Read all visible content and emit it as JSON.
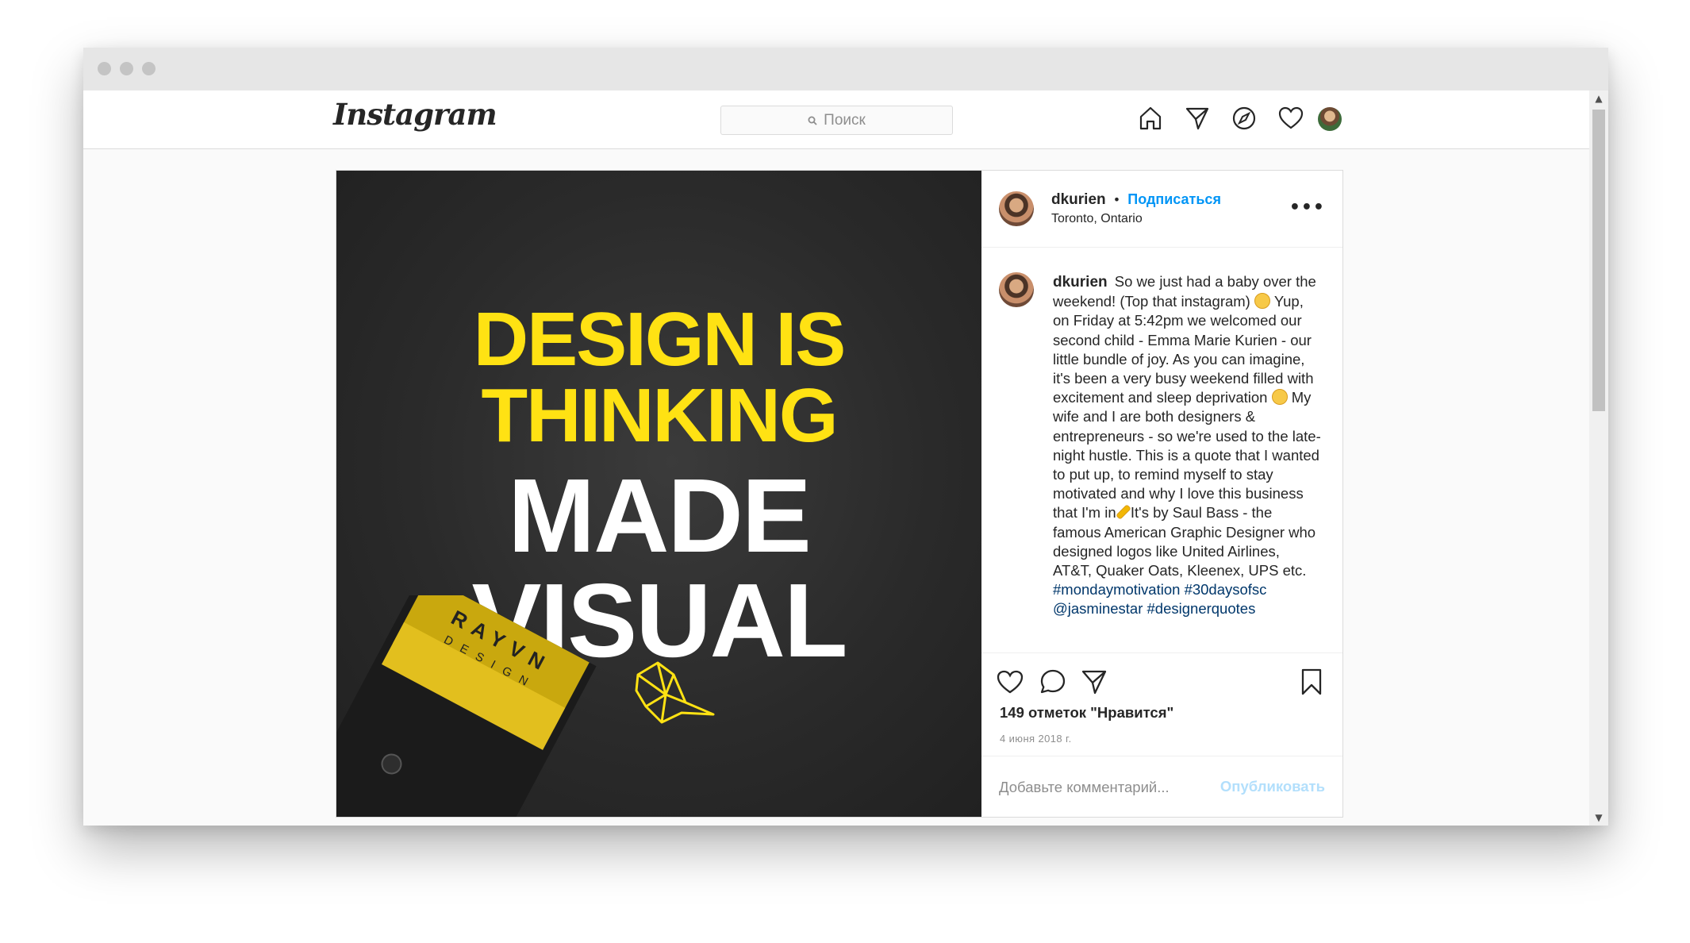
{
  "nav": {
    "logo": "Instagram",
    "search_placeholder": "Поиск",
    "icons": [
      "home-icon",
      "direct-icon",
      "explore-icon",
      "activity-icon",
      "profile-avatar"
    ]
  },
  "post": {
    "image_text": {
      "line1": "DESIGN IS",
      "line2": "THINKING",
      "line3": "MADE",
      "line4": "VISUAL",
      "envelope_brand": "RAYVN",
      "envelope_sub": "DESIGN"
    },
    "header": {
      "username": "dkurien",
      "separator": "•",
      "follow_label": "Подписаться",
      "location": "Toronto, Ontario"
    },
    "caption": {
      "username": "dkurien",
      "part1": "So we just had a baby over the weekend! (Top that instagram)",
      "part2": "Yup, on Friday at 5:42pm we welcomed our second child - Emma Marie Kurien - our little bundle of joy. As you can imagine, it's been a very busy weekend filled with excitement and sleep deprivation",
      "part3": "My wife and I are both designers & entrepreneurs - so we're used to the late-night hustle. This is a quote that I wanted to put up, to remind myself to stay motivated and why I love this business that I'm in",
      "part4": "It's by Saul Bass - the famous American Graphic Designer who designed logos like United Airlines, AT&T, Quaker Oats, Kleenex, UPS etc.",
      "tag1": "#mondaymotivation",
      "tag2": "#30daysofsc",
      "mention": "@jasminestar",
      "tag3": "#designerquotes"
    },
    "likes": "149 отметок \"Нравится\"",
    "date": "4 июня 2018 г.",
    "comment_placeholder": "Добавьте комментарий...",
    "publish_label": "Опубликовать"
  },
  "colors": {
    "accent": "#0095f6",
    "headline_yellow": "#ffe213",
    "border": "#dbdbdb"
  }
}
